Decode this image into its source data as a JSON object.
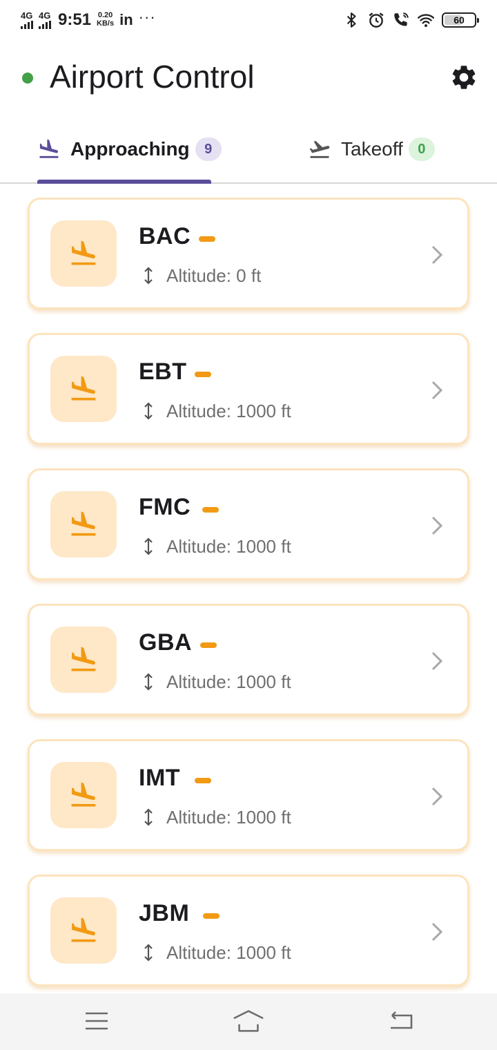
{
  "status_bar": {
    "network_1": "4G",
    "network_2": "4G",
    "time": "9:51",
    "speed_value": "0.20",
    "speed_unit": "KB/s",
    "app_indicator": "in",
    "more_dots": "···",
    "battery": "60",
    "battery_level": 0.6,
    "icons": [
      "bluetooth-icon",
      "alarm-icon",
      "wifi-call-icon",
      "wifi-icon",
      "battery-icon"
    ]
  },
  "app_bar": {
    "title": "Airport Control",
    "status_color": "#43a047",
    "settings_icon": "gear-icon"
  },
  "tabs": [
    {
      "label": "Approaching",
      "count": "9",
      "icon": "flight-land-icon",
      "selected": true
    },
    {
      "label": "Takeoff",
      "count": "0",
      "icon": "flight-takeoff-icon",
      "selected": false
    }
  ],
  "colors": {
    "accent": "#5b4e9a",
    "card_orange": "#f29a13",
    "card_tint": "#fee8c8",
    "badge_green": "#3aa24a"
  },
  "flights": [
    {
      "code": "BAC",
      "altitude": "Altitude: 0 ft"
    },
    {
      "code": "EBT",
      "altitude": "Altitude: 1000 ft"
    },
    {
      "code": "FMC",
      "altitude": "Altitude: 1000 ft"
    },
    {
      "code": "GBA",
      "altitude": "Altitude: 1000 ft"
    },
    {
      "code": "IMT",
      "altitude": "Altitude: 1000 ft"
    },
    {
      "code": "JBM",
      "altitude": "Altitude: 1000 ft"
    }
  ],
  "nav_bar": {
    "icons": [
      "menu-icon",
      "home-icon",
      "back-icon"
    ]
  }
}
